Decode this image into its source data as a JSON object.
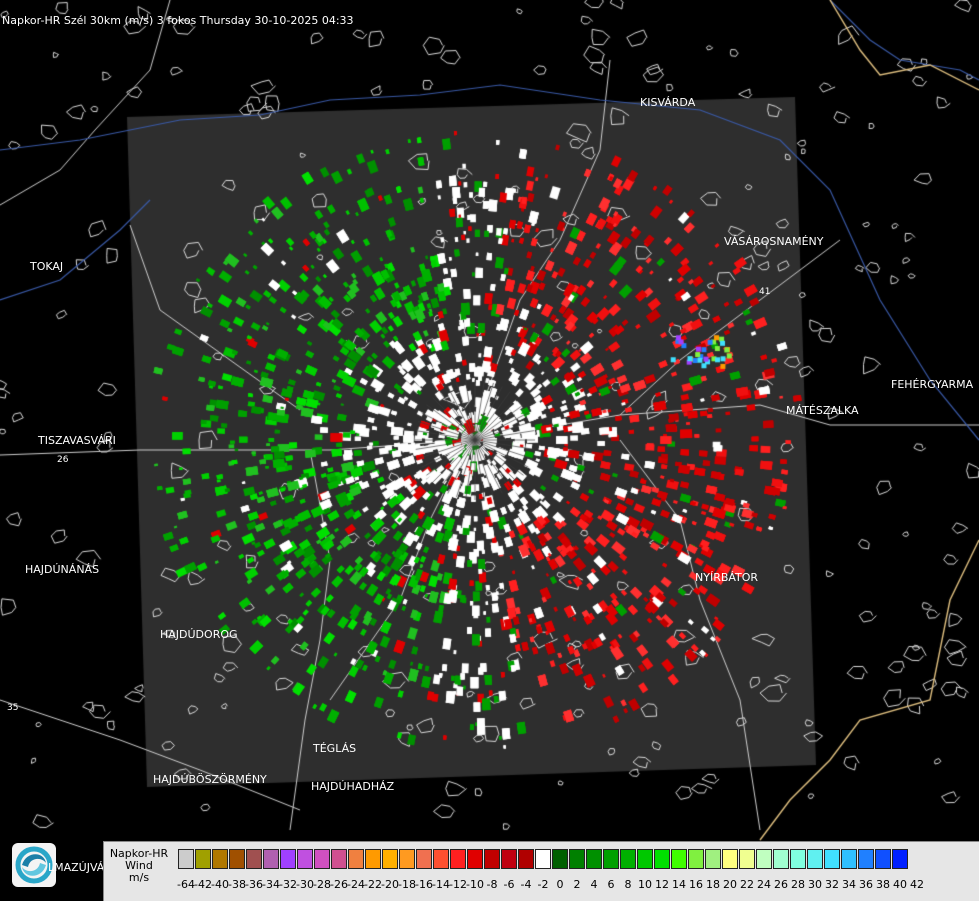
{
  "title": "Napkor-HR Szél 30km (m/s) 3 fokos Thursday 30-10-2025 04:33",
  "places": {
    "kisvarda": "KISVÁRDA",
    "tokaj": "TOKAJ",
    "vasarosnameny": "VÁSÁROSNAMÉNY",
    "tiszavasvari": "TISZAVASVÁRI",
    "mateszalka": "MÁTÉSZALKA",
    "fehergyarmat": "FEHÉRGYARMA",
    "hajdunanas": "HAJDÚNÁNÁS",
    "nyirbator": "NYÍRBÁTOR",
    "hajdudorog": "HAJDÚDOROG",
    "teglas": "TÉGLÁS",
    "hajduboszormeny": "HAJDÚBÖSZÖRMÉNY",
    "hajduhadhaz": "HAJDÚHADHÁZ"
  },
  "road_numbers": {
    "r26": "26",
    "r35": "35",
    "r41": "41"
  },
  "logo": {
    "icon": "swirl-logo-icon",
    "text": "LMAZÚJVÁR"
  },
  "legend": {
    "line1": "Napkor-HR",
    "line2": "Wind",
    "line3": "m/s",
    "values": [
      "-64",
      "-42",
      "-40",
      "-38",
      "-36",
      "-34",
      "-32",
      "-30",
      "-28",
      "-26",
      "-24",
      "-22",
      "-20",
      "-18",
      "-16",
      "-14",
      "-12",
      "-10",
      "-8",
      "-6",
      "-4",
      "-2",
      "0",
      "2",
      "4",
      "6",
      "8",
      "10",
      "12",
      "14",
      "16",
      "18",
      "20",
      "22",
      "24",
      "26",
      "28",
      "30",
      "32",
      "34",
      "36",
      "38",
      "40",
      "42"
    ],
    "colors": [
      "#cccccc",
      "#a0a000",
      "#b07800",
      "#a05000",
      "#a05050",
      "#b060b0",
      "#a040ff",
      "#c050e0",
      "#d050c0",
      "#d05090",
      "#f08040",
      "#ff9a00",
      "#ffb000",
      "#ff9a20",
      "#f07050",
      "#ff5030",
      "#ff2020",
      "#e00000",
      "#c00000",
      "#c00010",
      "#b00000",
      "#ffffff",
      "#006000",
      "#008000",
      "#009000",
      "#00a000",
      "#00b000",
      "#00c800",
      "#00e000",
      "#40ff00",
      "#80f040",
      "#a0f080",
      "#ffff80",
      "#f0ff90",
      "#c0ffc0",
      "#a0ffd0",
      "#80ffe0",
      "#60f0f0",
      "#40e0ff",
      "#30c0ff",
      "#2080ff",
      "#1050ff",
      "#0020ff"
    ]
  }
}
